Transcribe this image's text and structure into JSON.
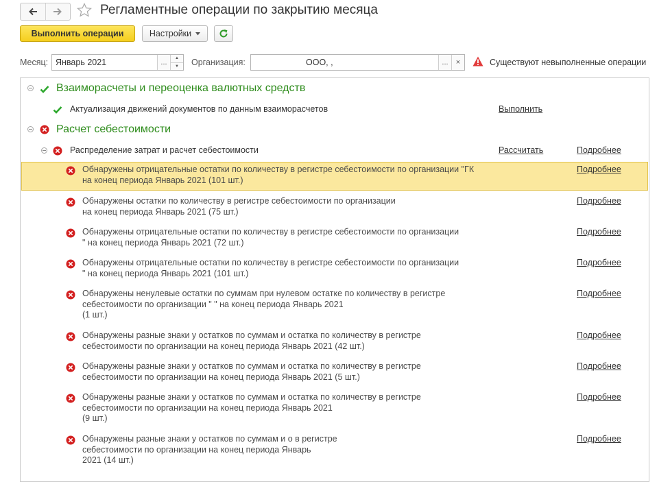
{
  "window": {
    "title": "Регламентные операции по закрытию месяца",
    "back_icon": "arrow-left-icon",
    "forward_icon": "arrow-right-icon",
    "favorite_icon": "star-icon"
  },
  "toolbar": {
    "run_label": "Выполнить операции",
    "settings_label": "Настройки",
    "refresh_icon": "refresh-icon"
  },
  "filters": {
    "month_label": "Месяц:",
    "month_value": "Январь 2021",
    "org_label": "Организация:",
    "org_value": "ООО, ,",
    "select_button": "...",
    "clear_button": "×",
    "warning_text": "Существуют невыполненные операции"
  },
  "colors": {
    "accent_yellow": "#f5cf1e",
    "ok_green": "#2e8c1c",
    "error_red": "#d32020",
    "selection": "#fbe89e"
  },
  "tree": {
    "group1": {
      "title": "Взаиморасчеты и переоценка валютных средств",
      "status_icon": "check-icon",
      "operation": {
        "text": "Актуализация движений документов по данным взаиморасчетов",
        "action": "Выполнить",
        "status_icon": "check-icon"
      }
    },
    "group2": {
      "title": "Расчет себестоимости",
      "status_icon": "error-icon",
      "operation": {
        "text": "Распределение затрат и расчет себестоимости",
        "action": "Рассчитать",
        "details": "Подробнее",
        "status_icon": "error-icon"
      },
      "errors": [
        {
          "text": "Обнаружены отрицательные остатки по количеству в регистре себестоимости по организации \"ГК\n на конец периода Январь 2021 (101 шт.)",
          "details": "Подробнее"
        },
        {
          "text": "Обнаружены       остатки по количеству в регистре себестоимости по организации\n на конец периода Январь 2021 (75 шт.)",
          "details": "Подробнее"
        },
        {
          "text": "Обнаружены отрицательные остатки по количеству в регистре себестоимости по организации\n \" на конец периода Январь 2021 (72 шт.)",
          "details": "Подробнее"
        },
        {
          "text": "Обнаружены отрицательные остатки по количеству в регистре себестоимости по организации\n \" на конец периода Январь 2021 (101 шт.)",
          "details": "Подробнее"
        },
        {
          "text": "Обнаружены ненулевые остатки по суммам при нулевом остатке по количеству в регистре\nсебестоимости по организации \"                    \" на конец периода Январь 2021\n(1 шт.)",
          "details": "Подробнее"
        },
        {
          "text": "Обнаружены разные знаки у остатков по суммам и остатка по количеству в регистре\nсебестоимости по организации                       на конец периода Январь 2021 (42 шт.)",
          "details": "Подробнее"
        },
        {
          "text": "Обнаружены разные знаки у остатков по суммам и остатка по количеству в регистре\nсебестоимости по организации                        на конец периода Январь 2021 (5 шт.)",
          "details": "Подробнее"
        },
        {
          "text": "Обнаружены разные знаки у остатков по суммам и остатка по количеству в регистре\nсебестоимости по организации                        на конец периода Январь 2021\n(9 шт.)",
          "details": "Подробнее"
        },
        {
          "text": "Обнаружены разные знаки у остатков по суммам и о         в регистре\nсебестоимости по организации                        на конец периода Январь\n2021 (14 шт.)",
          "details": "Подробнее"
        }
      ]
    }
  }
}
